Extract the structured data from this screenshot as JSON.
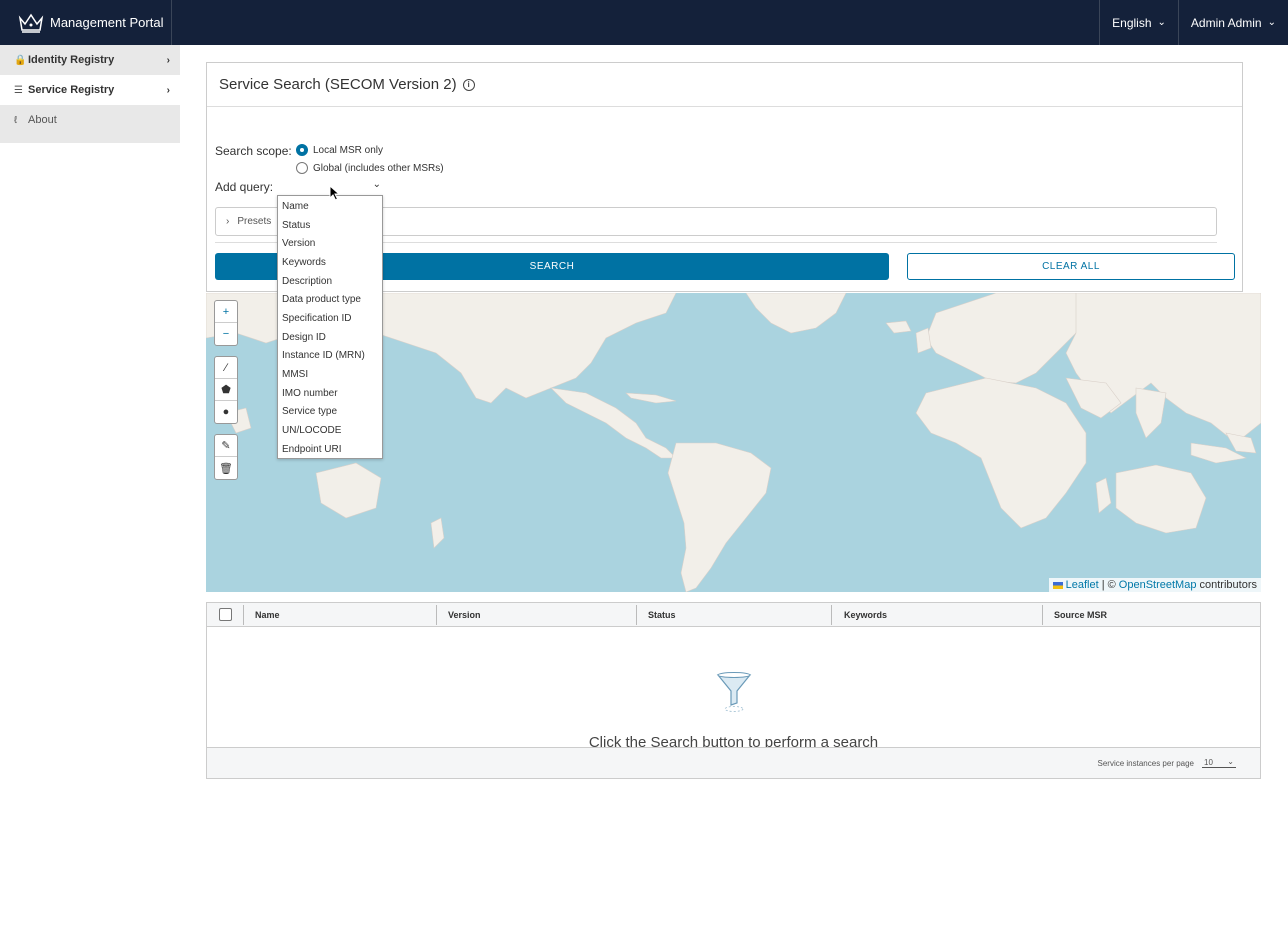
{
  "header": {
    "app_title": "Management Portal",
    "language": "English",
    "user": "Admin Admin"
  },
  "sidebar": {
    "items": [
      {
        "label": "Identity Registry",
        "icon": "lock-icon"
      },
      {
        "label": "Service Registry",
        "icon": "layers-icon"
      },
      {
        "label": "About",
        "icon": "thermometer-icon"
      }
    ]
  },
  "search_card": {
    "title": "Service Search (SECOM Version 2)",
    "scope_label": "Search scope:",
    "scope_options": [
      "Local MSR only",
      "Global (includes other MSRs)"
    ],
    "scope_selected": "Local MSR only",
    "add_query_label": "Add query:",
    "presets_label": "Presets",
    "search_button": "SEARCH",
    "clear_button": "CLEAR ALL"
  },
  "query_dropdown": {
    "options": [
      "Name",
      "Status",
      "Version",
      "Keywords",
      "Description",
      "Data product type",
      "Specification ID",
      "Design ID",
      "Instance ID (MRN)",
      "MMSI",
      "IMO number",
      "Service type",
      "UN/LOCODE",
      "Endpoint URI"
    ]
  },
  "map": {
    "zoom_in": "+",
    "zoom_out": "−",
    "attribution_leaflet": "Leaflet",
    "attribution_sep": "| ©",
    "attribution_osm": "OpenStreetMap",
    "attribution_tail": "contributors"
  },
  "results_table": {
    "columns": [
      "Name",
      "Version",
      "Status",
      "Keywords",
      "Source MSR"
    ],
    "empty_message": "Click the Search button to perform a search",
    "per_page_label": "Service instances per page",
    "per_page_value": "10"
  }
}
